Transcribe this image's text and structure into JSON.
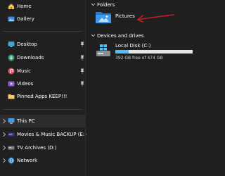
{
  "sidebar": {
    "top_items": [
      {
        "label": "Home",
        "icon": "home-icon"
      },
      {
        "label": "Gallery",
        "icon": "gallery-icon"
      }
    ],
    "quick_access": [
      {
        "label": "Desktop",
        "icon": "desktop-icon",
        "pinned": true
      },
      {
        "label": "Downloads",
        "icon": "downloads-icon",
        "pinned": true
      },
      {
        "label": "Music",
        "icon": "music-icon",
        "pinned": true
      },
      {
        "label": "Videos",
        "icon": "videos-icon",
        "pinned": true
      },
      {
        "label": "Pinned Apps KEEP!!!",
        "icon": "folder-icon",
        "pinned": false
      }
    ],
    "locations": [
      {
        "label": "This PC",
        "icon": "this-pc-icon",
        "selected": true
      },
      {
        "label": "Movies & Music BACKUP (E:)",
        "icon": "drive-icon",
        "selected": false
      },
      {
        "label": "TV Archives (D:)",
        "icon": "drive-icon",
        "selected": false
      },
      {
        "label": "Network",
        "icon": "network-icon",
        "selected": false
      }
    ]
  },
  "main": {
    "folders_header": "Folders",
    "folders": [
      {
        "label": "Pictures",
        "icon": "pictures-folder-icon"
      }
    ],
    "devices_header": "Devices and drives",
    "drives": [
      {
        "name": "Local Disk (C:)",
        "free_text": "392 GB free of 474 GB",
        "used_fraction": 0.17
      }
    ]
  },
  "colors": {
    "background": "#1f1f1f",
    "sidebar": "#202020",
    "selected": "#2d2d2d",
    "accent": "#4cc2ff",
    "annotation_arrow": "#d11a1a"
  }
}
